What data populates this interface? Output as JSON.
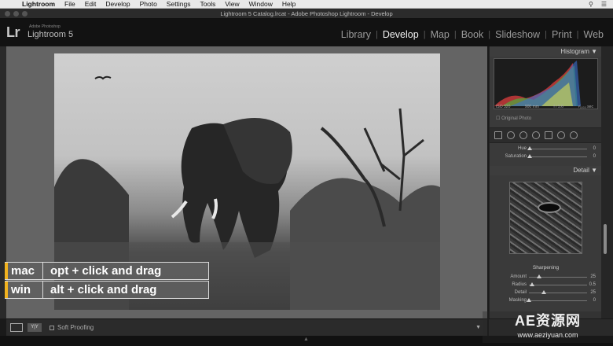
{
  "menubar": {
    "apple_icon": "apple-icon",
    "items": [
      "Lightroom",
      "File",
      "Edit",
      "Develop",
      "Photo",
      "Settings",
      "Tools",
      "View",
      "Window",
      "Help"
    ]
  },
  "window": {
    "title": "Lightroom 5 Catalog.lrcat - Adobe Photoshop Lightroom - Develop"
  },
  "identity": {
    "lr": "Lr",
    "sub": "Adobe Photoshop",
    "name": "Lightroom 5"
  },
  "modules": [
    "Library",
    "Develop",
    "Map",
    "Book",
    "Slideshow",
    "Print",
    "Web"
  ],
  "active_module": "Develop",
  "histogram": {
    "header": "Histogram ▼",
    "iso": "ISO 320",
    "focal": "900 mm",
    "aperture": "f / 5.6",
    "shutter": "¹⁄₁₆₀₀ sec",
    "original_photo": "Original Photo"
  },
  "hsl": {
    "hue_label": "Hue",
    "hue_value": "0",
    "saturation_label": "Saturation",
    "saturation_value": "0"
  },
  "detail": {
    "header": "Detail ▼",
    "sharpening_header": "Sharpening",
    "sliders": [
      {
        "label": "Amount",
        "value": "25",
        "pos": 0.17
      },
      {
        "label": "Radius",
        "value": "0.5",
        "pos": 0.05
      },
      {
        "label": "Detail",
        "value": "25",
        "pos": 0.25
      },
      {
        "label": "Masking",
        "value": "0",
        "pos": 0.0
      }
    ]
  },
  "toolbar": {
    "soft_proofing": "Soft Proofing"
  },
  "shortcut": {
    "mac_os": "mac",
    "mac_keys": "opt + click and drag",
    "win_os": "win",
    "win_keys": "alt + click and drag"
  },
  "watermark": {
    "main": "AE资源网",
    "url": "www.aeziyuan.com"
  },
  "colors": {
    "accent_bar": "#f2b31f",
    "active_module": "#f2f2f2"
  }
}
